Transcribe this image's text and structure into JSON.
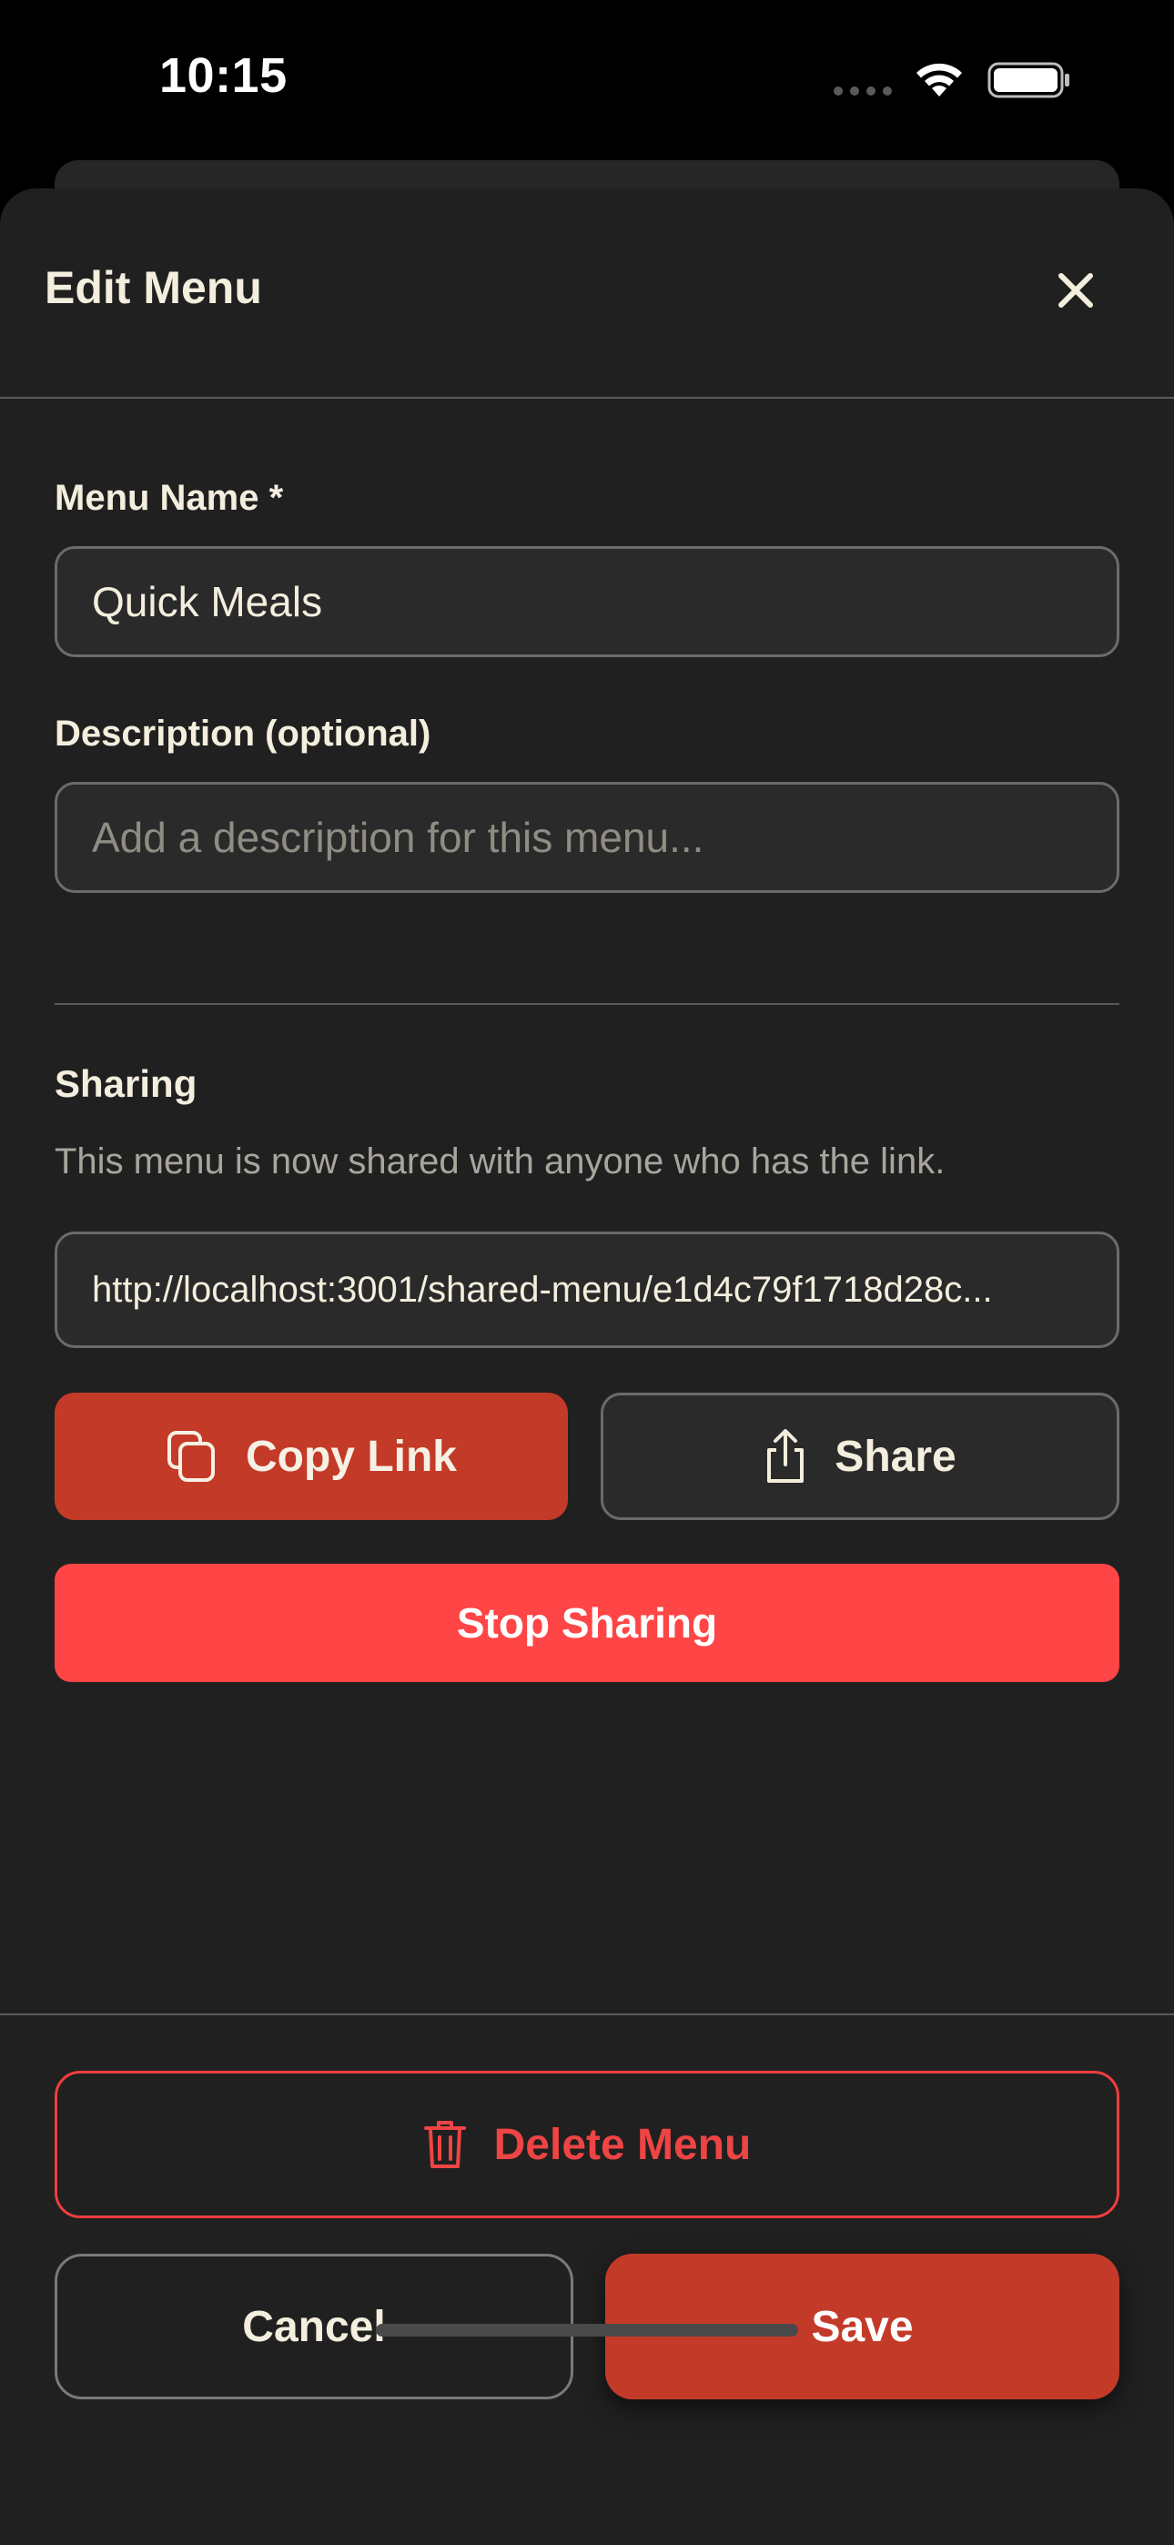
{
  "status_bar": {
    "time": "10:15"
  },
  "sheet": {
    "title": "Edit Menu",
    "close_icon": "close-icon"
  },
  "form": {
    "name_label": "Menu Name *",
    "name_value": "Quick Meals",
    "description_label": "Description (optional)",
    "description_value": "",
    "description_placeholder": "Add a description for this menu..."
  },
  "sharing": {
    "heading": "Sharing",
    "helper": "This menu is now shared with anyone who has the link.",
    "link": "http://localhost:3001/shared-menu/e1d4c79f1718d28c...",
    "copy_label": "Copy Link",
    "copy_icon": "copy-icon",
    "share_label": "Share",
    "share_icon": "share-icon",
    "stop_label": "Stop Sharing"
  },
  "footer": {
    "delete_label": "Delete Menu",
    "delete_icon": "trash-icon",
    "cancel_label": "Cancel",
    "save_label": "Save"
  },
  "colors": {
    "background": "#202020",
    "accent": "#c43a28",
    "danger": "#ff4545",
    "text": "#f3eedd"
  }
}
